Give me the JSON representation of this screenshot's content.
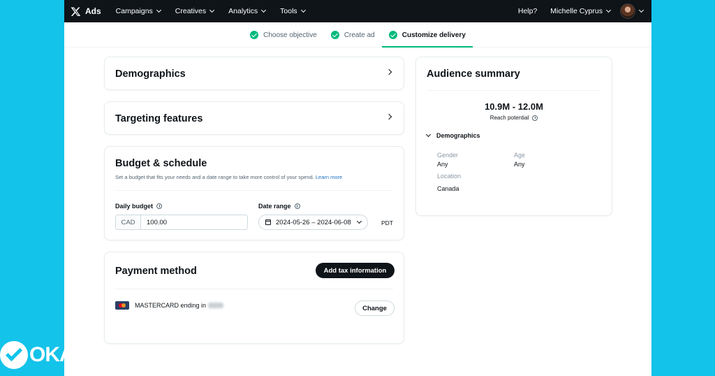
{
  "nav": {
    "brand": "Ads",
    "items": [
      "Campaigns",
      "Creatives",
      "Analytics",
      "Tools"
    ],
    "help": "Help?",
    "user": "Michelle Cyprus"
  },
  "steps": [
    {
      "label": "Choose objective"
    },
    {
      "label": "Create ad"
    },
    {
      "label": "Customize delivery"
    }
  ],
  "sections": {
    "demographics": "Demographics",
    "targeting": "Targeting features"
  },
  "budget": {
    "title": "Budget & schedule",
    "description": "Set a budget that fits your needs and a date range to take more control of your spend.",
    "learn_more": "Learn more",
    "daily_label": "Daily budget",
    "currency": "CAD",
    "amount": "100.00",
    "date_label": "Date range",
    "date_range": "2024-05-26 – 2024-06-08",
    "timezone": "PDT"
  },
  "payment": {
    "title": "Payment method",
    "add_tax": "Add tax information",
    "card": "MASTERCARD ending in",
    "change": "Change"
  },
  "summary": {
    "title": "Audience summary",
    "reach": "10.9M - 12.0M",
    "reach_label": "Reach potential",
    "demographics": "Demographics",
    "gender_label": "Gender",
    "gender": "Any",
    "age_label": "Age",
    "age": "Any",
    "location_label": "Location",
    "location": "Canada"
  },
  "watermark": "OKA",
  "colors": {
    "background": "#13c3ea",
    "nav": "#0f1419",
    "success": "#00ba7c",
    "link": "#1d74c4"
  }
}
